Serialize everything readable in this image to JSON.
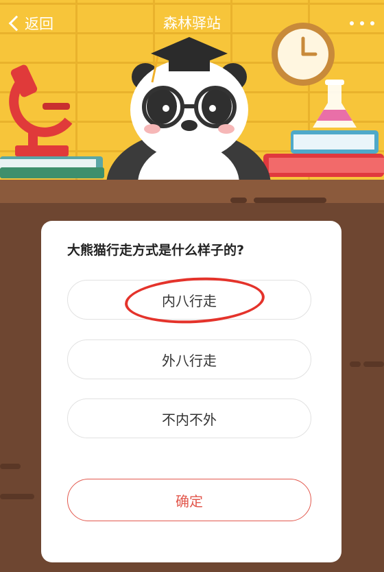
{
  "header": {
    "back_label": "返回",
    "title": "森林驿站"
  },
  "quiz": {
    "question": "大熊猫行走方式是什么样子的?",
    "options": [
      "内八行走",
      "外八行走",
      "不内不外"
    ],
    "confirm_label": "确定",
    "highlighted_option": "内八行走"
  },
  "colors": {
    "wall": "#f7c53a",
    "desk": "#6e4631",
    "accent": "#e2574c",
    "annotation": "#e4332b"
  },
  "icons": [
    "chevron-left-icon",
    "more-icon",
    "microscope-icon",
    "clock-icon",
    "flask-icon",
    "panda-mascot"
  ]
}
